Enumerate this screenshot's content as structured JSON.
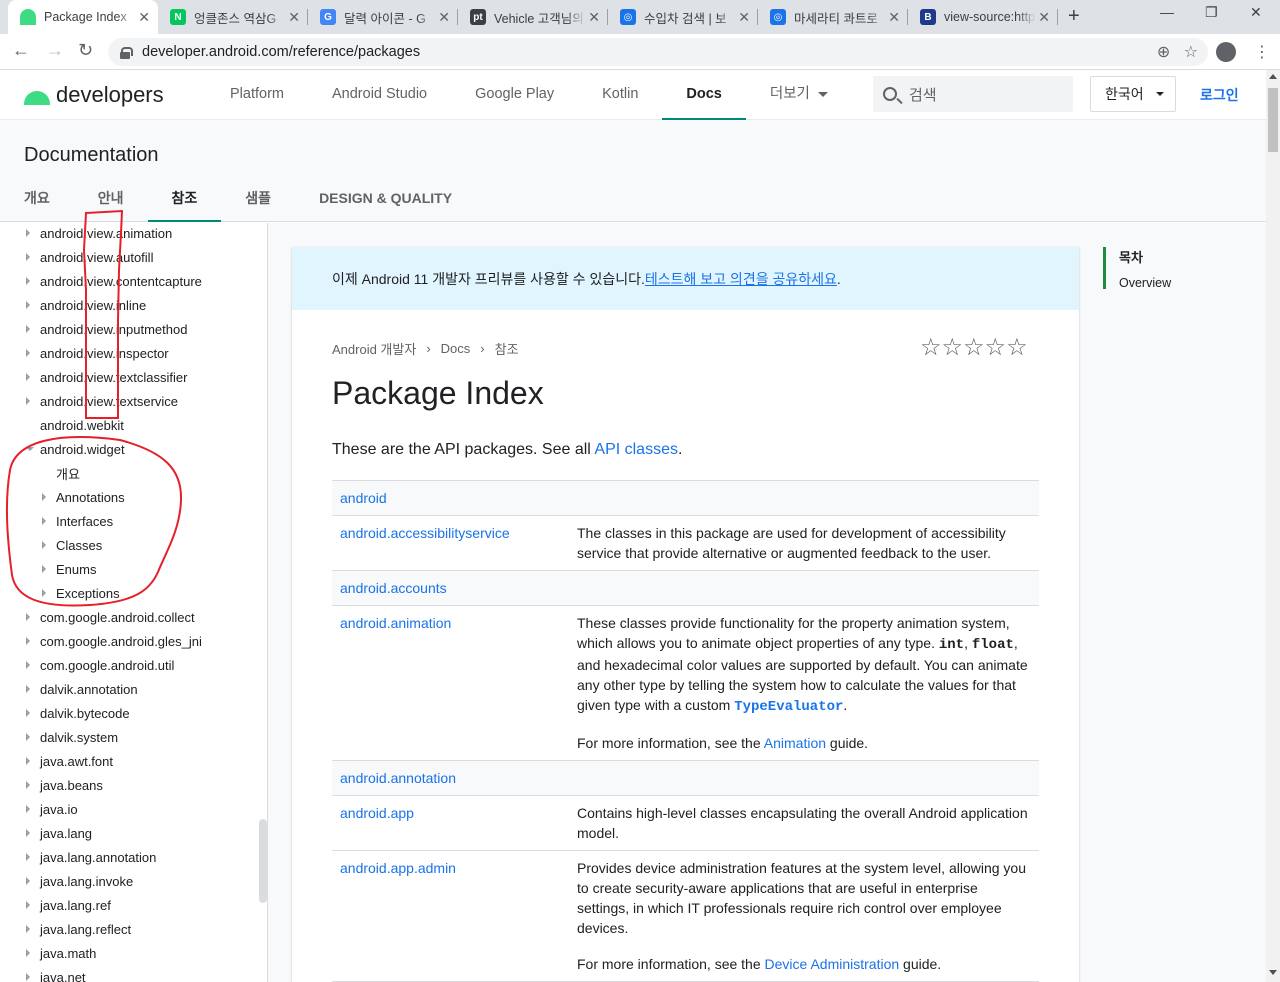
{
  "browser": {
    "tabs": [
      {
        "title": "Package Index",
        "favicon": "android-icon",
        "color": "#3ddc84",
        "active": true
      },
      {
        "title": "엉클존스 역삼G",
        "favicon": "naver-icon",
        "color": "#03c75a",
        "letter": "N"
      },
      {
        "title": "달력 아이콘 - G",
        "favicon": "google-icon",
        "color": "#4285f4",
        "letter": "G"
      },
      {
        "title": "Vehicle 고객님의",
        "favicon": "vehicle-icon",
        "color": "#3c4043",
        "letter": "pt"
      },
      {
        "title": "수입차 검색 | 보",
        "favicon": "car-icon",
        "color": "#1a73e8",
        "letter": "◎"
      },
      {
        "title": "마세라티 콰트로",
        "favicon": "car-icon",
        "color": "#1a73e8",
        "letter": "◎"
      },
      {
        "title": "view-source:http",
        "favicon": "bootstrap-icon",
        "color": "#1e3a8a",
        "letter": "B"
      }
    ],
    "url": "developer.android.com/reference/packages"
  },
  "header": {
    "logo_text": "developers",
    "nav": [
      {
        "label": "Platform",
        "active": false
      },
      {
        "label": "Android Studio",
        "active": false
      },
      {
        "label": "Google Play",
        "active": false
      },
      {
        "label": "Kotlin",
        "active": false
      },
      {
        "label": "Docs",
        "active": true
      },
      {
        "label": "더보기",
        "active": false,
        "dropdown": true
      }
    ],
    "search_placeholder": "검색",
    "language": "한국어",
    "login": "로그인"
  },
  "docbar": {
    "title": "Documentation",
    "tabs": [
      {
        "label": "개요",
        "active": false
      },
      {
        "label": "안내",
        "active": false
      },
      {
        "label": "참조",
        "active": true
      },
      {
        "label": "샘플",
        "active": false
      },
      {
        "label": "DESIGN & QUALITY",
        "active": false
      }
    ]
  },
  "sidebar": {
    "items": [
      {
        "label": "android.view.animation",
        "level": 0,
        "expanded": false
      },
      {
        "label": "android.view.autofill",
        "level": 0,
        "expanded": false
      },
      {
        "label": "android.view.contentcapture",
        "level": 0,
        "expanded": false
      },
      {
        "label": "android.view.inline",
        "level": 0,
        "expanded": false
      },
      {
        "label": "android.view.inputmethod",
        "level": 0,
        "expanded": false
      },
      {
        "label": "android.view.inspector",
        "level": 0,
        "expanded": false
      },
      {
        "label": "android.view.textclassifier",
        "level": 0,
        "expanded": false
      },
      {
        "label": "android.view.textservice",
        "level": 0,
        "expanded": false
      },
      {
        "label": "android.webkit",
        "level": 0,
        "leaf": true
      },
      {
        "label": "android.widget",
        "level": 0,
        "expanded": true
      },
      {
        "label": "개요",
        "level": 1,
        "leaf": true
      },
      {
        "label": "Annotations",
        "level": 1,
        "expanded": false
      },
      {
        "label": "Interfaces",
        "level": 1,
        "expanded": false
      },
      {
        "label": "Classes",
        "level": 1,
        "expanded": false
      },
      {
        "label": "Enums",
        "level": 1,
        "expanded": false
      },
      {
        "label": "Exceptions",
        "level": 1,
        "expanded": false
      },
      {
        "label": "com.google.android.collect",
        "level": 0,
        "expanded": false
      },
      {
        "label": "com.google.android.gles_jni",
        "level": 0,
        "expanded": false
      },
      {
        "label": "com.google.android.util",
        "level": 0,
        "expanded": false
      },
      {
        "label": "dalvik.annotation",
        "level": 0,
        "expanded": false
      },
      {
        "label": "dalvik.bytecode",
        "level": 0,
        "expanded": false
      },
      {
        "label": "dalvik.system",
        "level": 0,
        "expanded": false
      },
      {
        "label": "java.awt.font",
        "level": 0,
        "expanded": false
      },
      {
        "label": "java.beans",
        "level": 0,
        "expanded": false
      },
      {
        "label": "java.io",
        "level": 0,
        "expanded": false
      },
      {
        "label": "java.lang",
        "level": 0,
        "expanded": false
      },
      {
        "label": "java.lang.annotation",
        "level": 0,
        "expanded": false
      },
      {
        "label": "java.lang.invoke",
        "level": 0,
        "expanded": false
      },
      {
        "label": "java.lang.ref",
        "level": 0,
        "expanded": false
      },
      {
        "label": "java.lang.reflect",
        "level": 0,
        "expanded": false
      },
      {
        "label": "java.math",
        "level": 0,
        "expanded": false
      },
      {
        "label": "java.net",
        "level": 0,
        "expanded": false
      }
    ]
  },
  "main": {
    "banner_text": "이제 Android 11 개발자 프리뷰를 사용할 수 있습니다. ",
    "banner_link": "테스트해 보고 의견을 공유하세요",
    "banner_end": ".",
    "breadcrumbs": [
      "Android 개발자",
      "Docs",
      "참조"
    ],
    "rating_stars": "☆☆☆☆☆",
    "title": "Package Index",
    "intro_text": "These are the API packages. See all ",
    "intro_link": "API classes",
    "intro_end": ".",
    "packages": [
      {
        "name": "android",
        "desc": []
      },
      {
        "name": "android.accessibilityservice",
        "desc": [
          [
            {
              "t": "The classes in this package are used for development of accessibility service that provide alternative or augmented feedback to the user."
            }
          ]
        ]
      },
      {
        "name": "android.accounts",
        "desc": []
      },
      {
        "name": "android.animation",
        "desc": [
          [
            {
              "t": "These classes provide functionality for the property animation system, which allows you to animate object properties of any type. "
            },
            {
              "t": "int",
              "code": true
            },
            {
              "t": ", "
            },
            {
              "t": "float",
              "code": true
            },
            {
              "t": ", and hexadecimal color values are supported by default. You can animate any other type by telling the system how to calculate the values for that given type with a custom "
            },
            {
              "t": "TypeEvaluator",
              "code": true,
              "link": true
            },
            {
              "t": "."
            }
          ],
          [
            {
              "t": "For more information, see the "
            },
            {
              "t": "Animation",
              "link": true
            },
            {
              "t": " guide."
            }
          ]
        ]
      },
      {
        "name": "android.annotation",
        "desc": []
      },
      {
        "name": "android.app",
        "desc": [
          [
            {
              "t": "Contains high-level classes encapsulating the overall Android application model."
            }
          ]
        ]
      },
      {
        "name": "android.app.admin",
        "desc": [
          [
            {
              "t": "Provides device administration features at the system level, allowing you to create security-aware applications that are useful in enterprise settings, in which IT professionals require rich control over employee devices."
            }
          ],
          [
            {
              "t": "For more information, see the "
            },
            {
              "t": "Device Administration",
              "link": true
            },
            {
              "t": " guide."
            }
          ]
        ]
      }
    ]
  },
  "toc": {
    "heading": "목차",
    "items": [
      "Overview"
    ]
  },
  "colors": {
    "accent": "#1a73e8",
    "android_green": "#3ddc84",
    "active_tab_underline": "#00897b",
    "annotation": "#e5202a"
  }
}
